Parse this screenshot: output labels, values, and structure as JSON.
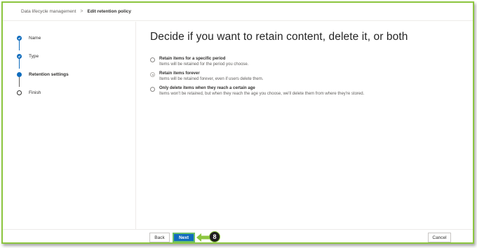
{
  "breadcrumb": {
    "parent": "Data lifecycle management",
    "separator": ">",
    "current": "Edit retention policy"
  },
  "steps": [
    {
      "label": "Name",
      "state": "done"
    },
    {
      "label": "Type",
      "state": "done"
    },
    {
      "label": "Retention settings",
      "state": "current"
    },
    {
      "label": "Finish",
      "state": "todo"
    }
  ],
  "main": {
    "heading": "Decide if you want to retain content, delete it, or both",
    "options": [
      {
        "title": "Retain items for a specific period",
        "description": "Items will be retained for the period you choose.",
        "selected": false
      },
      {
        "title": "Retain items forever",
        "description": "Items will be retained forever, even if users delete them.",
        "selected": true
      },
      {
        "title": "Only delete items when they reach a certain age",
        "description": "Items won't be retained, but when they reach the age you choose, we'll delete them from where they're stored.",
        "selected": false
      }
    ]
  },
  "footer": {
    "back_label": "Back",
    "next_label": "Next",
    "cancel_label": "Cancel"
  },
  "callout": {
    "number": "8"
  },
  "colors": {
    "accent": "#0f6cbd",
    "frame_border": "#8cc63f",
    "callout_badge": "#1f1f1f"
  }
}
